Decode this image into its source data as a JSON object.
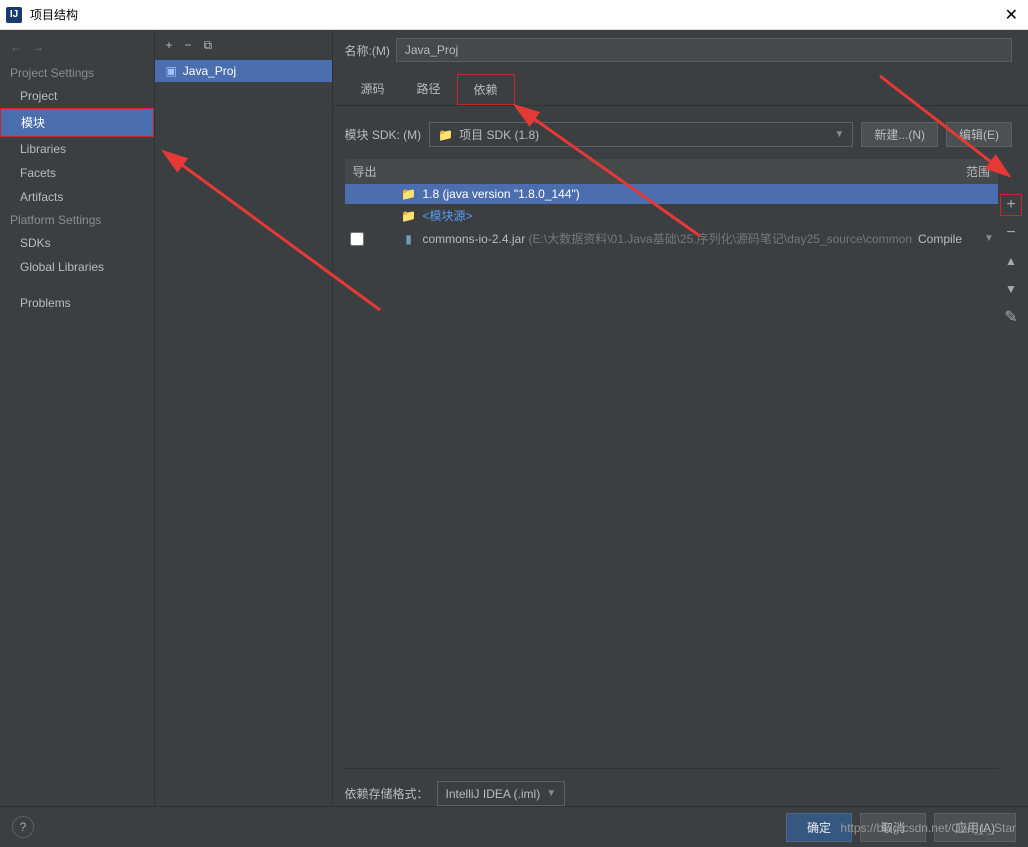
{
  "window": {
    "title": "项目结构"
  },
  "sidebar": {
    "project_settings_label": "Project Settings",
    "platform_settings_label": "Platform Settings",
    "items": {
      "project": "Project",
      "modules": "模块",
      "libraries": "Libraries",
      "facets": "Facets",
      "artifacts": "Artifacts",
      "sdks": "SDKs",
      "global_libraries": "Global Libraries",
      "problems": "Problems"
    }
  },
  "module_list": {
    "selected": "Java_Proj"
  },
  "form": {
    "name_label": "名称:(M)",
    "name_value": "Java_Proj"
  },
  "tabs": {
    "source": "源码",
    "paths": "路径",
    "dependencies": "依赖"
  },
  "sdk": {
    "label": "模块 SDK:  (M)",
    "value": "项目 SDK (1.8)",
    "new_btn": "新建...(N)",
    "edit_btn": "编辑(E)"
  },
  "dep_table": {
    "export_hdr": "导出",
    "scope_hdr": "范围",
    "rows": [
      {
        "text": "1.8 (java version \"1.8.0_144\")",
        "kind": "sdk",
        "selected": true
      },
      {
        "text": "<模块源>",
        "kind": "module-src"
      },
      {
        "text": "commons-io-2.4.jar",
        "path": "(E:\\大数据资料\\01.Java基础\\25.序列化\\源码笔记\\day25_source\\common",
        "scope": "Compile",
        "kind": "jar",
        "checkbox": true
      }
    ]
  },
  "storage": {
    "label": "依赖存储格式：",
    "value": "IntelliJ IDEA (.iml)"
  },
  "buttons": {
    "ok": "确定",
    "cancel": "取消",
    "apply": "应用(A)"
  },
  "watermark": "https://blog.csdn.net/One_L_Star"
}
